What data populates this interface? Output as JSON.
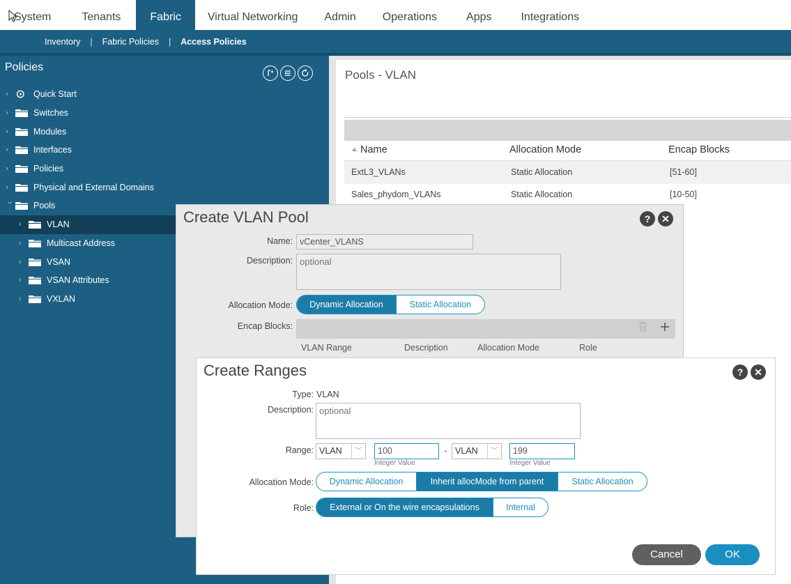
{
  "topnav": {
    "tabs": [
      {
        "label": "System"
      },
      {
        "label": "Tenants"
      },
      {
        "label": "Fabric"
      },
      {
        "label": "Virtual Networking"
      },
      {
        "label": "Admin"
      },
      {
        "label": "Operations"
      },
      {
        "label": "Apps"
      },
      {
        "label": "Integrations"
      }
    ],
    "active": "Fabric"
  },
  "subnav": {
    "items": [
      "Inventory",
      "Fabric Policies",
      "Access Policies"
    ],
    "separator": "|",
    "active": "Access Policies"
  },
  "sidebar": {
    "title": "Policies",
    "tools": [
      "add-icon",
      "list-icon",
      "refresh-icon"
    ],
    "items": [
      {
        "label": "Quick Start",
        "icon": "quickstart-icon"
      },
      {
        "label": "Switches",
        "icon": "folder-icon"
      },
      {
        "label": "Modules",
        "icon": "folder-icon"
      },
      {
        "label": "Interfaces",
        "icon": "folder-icon"
      },
      {
        "label": "Policies",
        "icon": "folder-icon"
      },
      {
        "label": "Physical and External Domains",
        "icon": "folder-icon"
      },
      {
        "label": "Pools",
        "icon": "folder-icon",
        "expanded": true
      },
      {
        "label": "VLAN",
        "icon": "folder-icon",
        "selected": true
      },
      {
        "label": "Multicast Address",
        "icon": "folder-icon"
      },
      {
        "label": "VSAN",
        "icon": "folder-icon"
      },
      {
        "label": "VSAN Attributes",
        "icon": "folder-icon"
      },
      {
        "label": "VXLAN",
        "icon": "folder-icon"
      }
    ]
  },
  "main": {
    "title": "Pools - VLAN",
    "columns": [
      "Name",
      "Allocation Mode",
      "Encap Blocks"
    ],
    "sort_icon": "sort-asc-icon",
    "rows": [
      {
        "name": "ExtL3_VLANs",
        "mode": "Static Allocation",
        "blocks": "[51-60]"
      },
      {
        "name": "Sales_phydom_VLANs",
        "mode": "Static Allocation",
        "blocks": "[10-50]"
      }
    ]
  },
  "create_vlan_pool": {
    "title": "Create VLAN Pool",
    "help": "?",
    "close": "✕",
    "name_label": "Name:",
    "name_value": "vCenter_VLANS",
    "description_label": "Description:",
    "description_placeholder": "optional",
    "allocation_label": "Allocation Mode:",
    "allocation_options": [
      "Dynamic Allocation",
      "Static Allocation"
    ],
    "allocation_selected": "Dynamic Allocation",
    "encap_label": "Encap Blocks:",
    "encap_columns": [
      "VLAN Range",
      "Description",
      "Allocation Mode",
      "Role"
    ]
  },
  "create_ranges": {
    "title": "Create Ranges",
    "help": "?",
    "close": "✕",
    "type_label": "Type:",
    "type_value": "VLAN",
    "description_label": "Description:",
    "description_placeholder": "optional",
    "range_label": "Range:",
    "range_from_type": "VLAN",
    "range_from_value": "100",
    "range_to_type": "VLAN",
    "range_to_value": "199",
    "range_dash": "-",
    "integer_hint": "Integer Value",
    "allocation_label": "Allocation Mode:",
    "allocation_options": [
      "Dynamic Allocation",
      "Inherit allocMode from parent",
      "Static Allocation"
    ],
    "allocation_selected": "Inherit allocMode from parent",
    "role_label": "Role:",
    "role_options": [
      "External or On the wire encapsulations",
      "Internal"
    ],
    "role_selected": "External or On the wire encapsulations",
    "cancel_label": "Cancel",
    "ok_label": "OK"
  },
  "colors": {
    "brand": "#1d5f82",
    "accent": "#1b8fc1",
    "selected": "#113f58"
  }
}
